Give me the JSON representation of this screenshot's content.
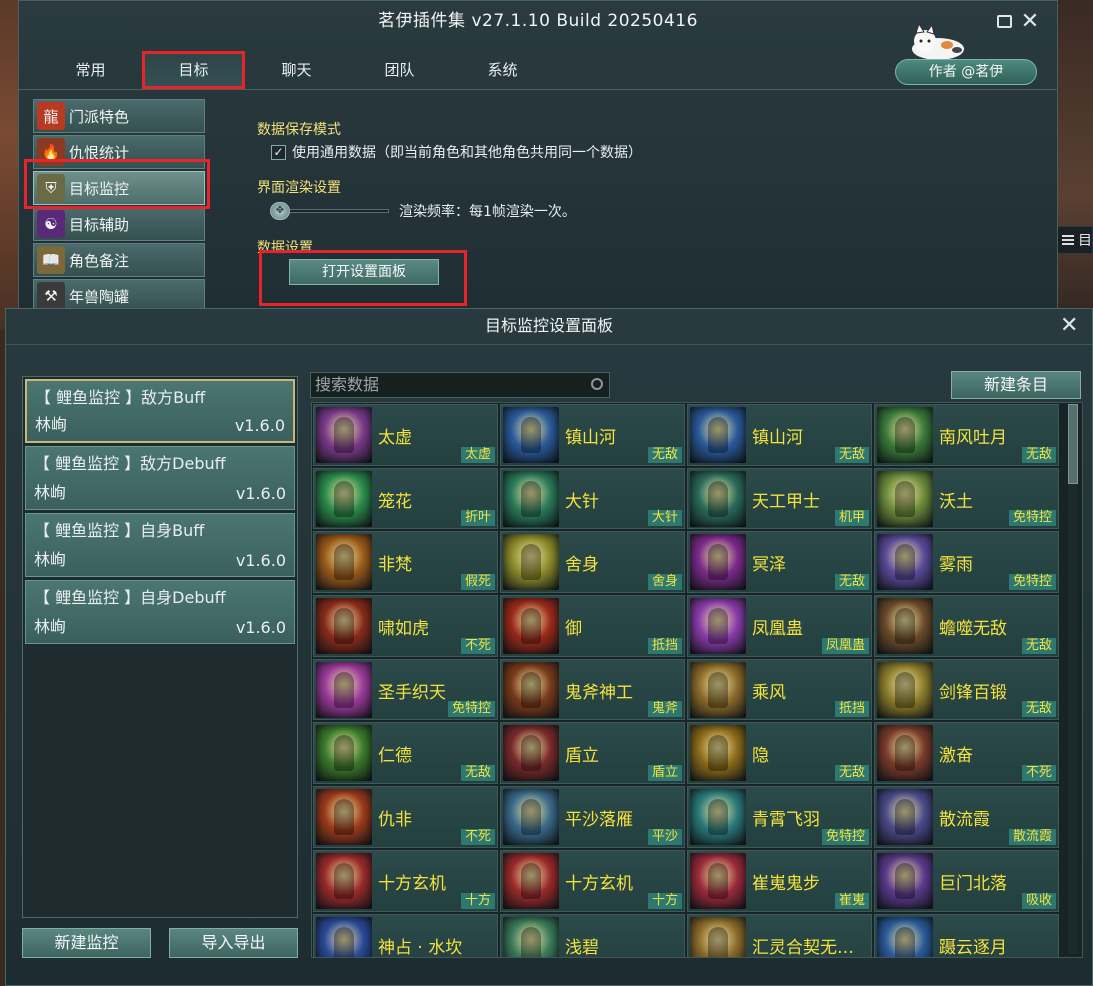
{
  "main_window": {
    "title": "茗伊插件集 v27.1.10 Build 20250416",
    "tabs": [
      "常用",
      "目标",
      "聊天",
      "团队",
      "系统"
    ],
    "active_tab": "目标",
    "author_label": "作者 @茗伊",
    "nav": [
      {
        "label": "门派特色",
        "icon": "dragon-icon",
        "color": "#b83a22"
      },
      {
        "label": "仇恨统计",
        "icon": "fire-icon",
        "color": "#8a3a22"
      },
      {
        "label": "目标监控",
        "icon": "armor-icon",
        "color": "#6a6a44",
        "active": true
      },
      {
        "label": "目标辅助",
        "icon": "purple-figure-icon",
        "color": "#5a2a7a"
      },
      {
        "label": "角色备注",
        "icon": "book-icon",
        "color": "#7a6a3a"
      },
      {
        "label": "年兽陶罐",
        "icon": "hammer-icon",
        "color": "#3a3a3a"
      }
    ],
    "settings": {
      "save_mode_title": "数据保存模式",
      "save_mode_option": "使用通用数据（即当前角色和其他角色共用同一个数据）",
      "render_title": "界面渲染设置",
      "render_text": "渲染频率：每1帧渲染一次。",
      "data_title": "数据设置",
      "open_panel_button": "打开设置面板"
    },
    "side_tag": "目"
  },
  "panel": {
    "title": "目标监控设置面板",
    "monitors": [
      {
        "name": "【 鲤鱼监控 】敌方Buff",
        "author": "林峋",
        "version": "v1.6.0",
        "active": true
      },
      {
        "name": "【 鲤鱼监控 】敌方Debuff",
        "author": "林峋",
        "version": "v1.6.0"
      },
      {
        "name": "【 鲤鱼监控 】自身Buff",
        "author": "林峋",
        "version": "v1.6.0"
      },
      {
        "name": "【 鲤鱼监控 】自身Debuff",
        "author": "林峋",
        "version": "v1.6.0"
      }
    ],
    "new_monitor_button": "新建监控",
    "import_export_button": "导入导出",
    "search_placeholder": "搜索数据",
    "new_entry_button": "新建条目",
    "skills": [
      {
        "name": "太虚",
        "tag": "太虚",
        "color": "#7a3a8a"
      },
      {
        "name": "镇山河",
        "tag": "无敌",
        "color": "#2a5a9a"
      },
      {
        "name": "镇山河",
        "tag": "无敌",
        "color": "#2a5a9a"
      },
      {
        "name": "南风吐月",
        "tag": "无敌",
        "color": "#3a7a3a"
      },
      {
        "name": "笼花",
        "tag": "折叶",
        "color": "#2a8a4a"
      },
      {
        "name": "大针",
        "tag": "大针",
        "color": "#2a7a5a"
      },
      {
        "name": "天工甲士",
        "tag": "机甲",
        "color": "#2a6a5a"
      },
      {
        "name": "沃土",
        "tag": "免特控",
        "color": "#6a8a3a"
      },
      {
        "name": "非梵",
        "tag": "假死",
        "color": "#9a5a1a"
      },
      {
        "name": "舍身",
        "tag": "舍身",
        "color": "#8a8a2a"
      },
      {
        "name": "冥泽",
        "tag": "无敌",
        "color": "#7a2a8a"
      },
      {
        "name": "雾雨",
        "tag": "免特控",
        "color": "#5a4a9a"
      },
      {
        "name": "啸如虎",
        "tag": "不死",
        "color": "#8a2a1a"
      },
      {
        "name": "御",
        "tag": "抵挡",
        "color": "#9a2a1a"
      },
      {
        "name": "凤凰蛊",
        "tag": "凤凰蛊",
        "color": "#8a3aaa"
      },
      {
        "name": "蟾噬无敌",
        "tag": "无敌",
        "color": "#6a4a2a"
      },
      {
        "name": "圣手织天",
        "tag": "免特控",
        "color": "#9a3a9a"
      },
      {
        "name": "鬼斧神工",
        "tag": "鬼斧",
        "color": "#7a3a1a"
      },
      {
        "name": "乘风",
        "tag": "抵挡",
        "color": "#8a6a2a"
      },
      {
        "name": "剑锋百锻",
        "tag": "无敌",
        "color": "#8a7a2a"
      },
      {
        "name": "仁德",
        "tag": "无敌",
        "color": "#3a7a2a"
      },
      {
        "name": "盾立",
        "tag": "盾立",
        "color": "#7a2a2a"
      },
      {
        "name": "隐",
        "tag": "无敌",
        "color": "#8a6a1a"
      },
      {
        "name": "激奋",
        "tag": "不死",
        "color": "#7a3a2a"
      },
      {
        "name": "仇非",
        "tag": "不死",
        "color": "#9a3a1a"
      },
      {
        "name": "平沙落雁",
        "tag": "平沙",
        "color": "#3a6a8a"
      },
      {
        "name": "青霄飞羽",
        "tag": "免特控",
        "color": "#2a7a7a"
      },
      {
        "name": "散流霞",
        "tag": "散流霞",
        "color": "#4a4a8a"
      },
      {
        "name": "十方玄机",
        "tag": "十方",
        "color": "#9a2a2a"
      },
      {
        "name": "十方玄机",
        "tag": "十方",
        "color": "#9a2a2a"
      },
      {
        "name": "崔嵬鬼步",
        "tag": "崔嵬",
        "color": "#9a2a3a"
      },
      {
        "name": "巨门北落",
        "tag": "吸收",
        "color": "#5a3a8a"
      },
      {
        "name": "神占 · 水坎",
        "tag": "",
        "color": "#2a4a9a"
      },
      {
        "name": "浅碧",
        "tag": "",
        "color": "#3a7a5a"
      },
      {
        "name": "汇灵合契无…",
        "tag": "",
        "color": "#8a6a2a"
      },
      {
        "name": "蹑云逐月",
        "tag": "",
        "color": "#2a5a9a"
      }
    ]
  }
}
